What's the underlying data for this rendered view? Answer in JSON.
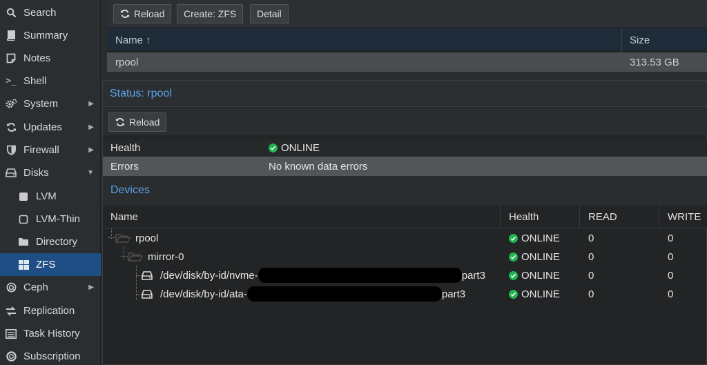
{
  "sidebar": {
    "items": [
      {
        "label": "Search",
        "icon": "search-icon"
      },
      {
        "label": "Summary",
        "icon": "book-icon"
      },
      {
        "label": "Notes",
        "icon": "notes-icon"
      },
      {
        "label": "Shell",
        "icon": "terminal-icon"
      },
      {
        "label": "System",
        "icon": "gears-icon",
        "arrow": "▶"
      },
      {
        "label": "Updates",
        "icon": "refresh-icon",
        "arrow": "▶"
      },
      {
        "label": "Firewall",
        "icon": "shield-icon",
        "arrow": "▶"
      },
      {
        "label": "Disks",
        "icon": "hdd-icon",
        "arrow": "▼"
      },
      {
        "label": "LVM",
        "icon": "square-icon"
      },
      {
        "label": "LVM-Thin",
        "icon": "square-outline-icon"
      },
      {
        "label": "Directory",
        "icon": "folder-icon"
      },
      {
        "label": "ZFS",
        "icon": "grid-icon"
      },
      {
        "label": "Ceph",
        "icon": "ceph-icon",
        "arrow": "▶"
      },
      {
        "label": "Replication",
        "icon": "replication-icon"
      },
      {
        "label": "Task History",
        "icon": "list-icon"
      },
      {
        "label": "Subscription",
        "icon": "support-icon"
      }
    ]
  },
  "toolbar": {
    "reload_label": "Reload",
    "create_label": "Create: ZFS",
    "detail_label": "Detail"
  },
  "pool_grid": {
    "col_name": "Name ↑",
    "col_size": "Size",
    "rows": [
      {
        "name": "rpool",
        "size": "313.53 GB"
      }
    ]
  },
  "status_window": {
    "title": "Status: rpool",
    "reload_label": "Reload",
    "health_key": "Health",
    "health_value": "ONLINE",
    "errors_key": "Errors",
    "errors_value": "No known data errors",
    "devices_title": "Devices",
    "columns": {
      "name": "Name",
      "health": "Health",
      "read": "READ",
      "write": "WRITE"
    },
    "devices": [
      {
        "name": "rpool",
        "health": "ONLINE",
        "read": "0",
        "write": "0"
      },
      {
        "name": "mirror-0",
        "health": "ONLINE",
        "read": "0",
        "write": "0"
      },
      {
        "name_prefix": "/dev/disk/by-id/nvme-",
        "name_suffix": "part3",
        "health": "ONLINE",
        "read": "0",
        "write": "0"
      },
      {
        "name_prefix": "/dev/disk/by-id/ata-",
        "name_suffix": "part3",
        "health": "ONLINE",
        "read": "0",
        "write": "0"
      }
    ]
  },
  "colors": {
    "accent": "#5aa3e6",
    "selected": "#1f4e85",
    "ok": "#21b351"
  }
}
